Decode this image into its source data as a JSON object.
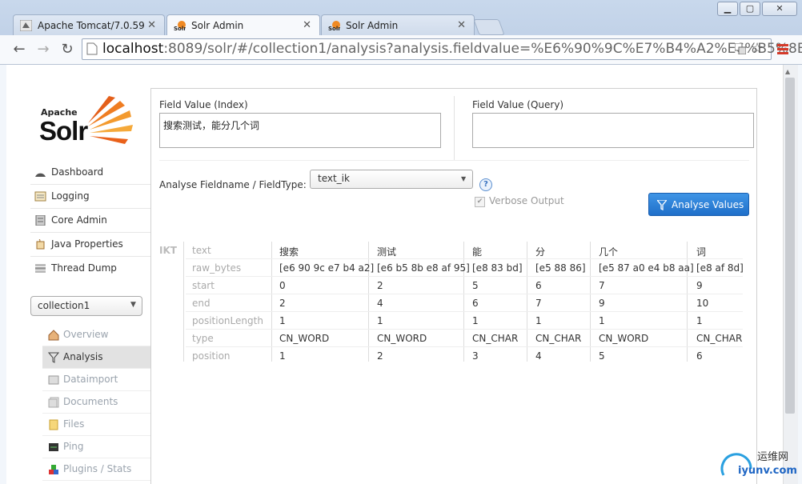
{
  "browser": {
    "tabs": [
      {
        "title": "Apache Tomcat/7.0.59"
      },
      {
        "title": "Solr Admin",
        "active": true
      },
      {
        "title": "Solr Admin"
      }
    ],
    "address": {
      "host": "localhost",
      "rest": ":8089/solr/#/collection1/analysis?analysis.fieldvalue=%E6%90%9C%E7%B4%A2%E6%B5%8B%E"
    }
  },
  "logo": {
    "apache": "Apache",
    "solr": "Solr"
  },
  "sidebar": {
    "items": [
      {
        "label": "Dashboard",
        "icon": "dashboard-icon"
      },
      {
        "label": "Logging",
        "icon": "logging-icon"
      },
      {
        "label": "Core Admin",
        "icon": "core-admin-icon"
      },
      {
        "label": "Java Properties",
        "icon": "java-icon"
      },
      {
        "label": "Thread Dump",
        "icon": "thread-dump-icon"
      }
    ],
    "core_selector": "collection1",
    "core_items": [
      {
        "label": "Overview",
        "icon": "home-icon"
      },
      {
        "label": "Analysis",
        "icon": "filter-icon",
        "active": true
      },
      {
        "label": "Dataimport",
        "icon": "dataimport-icon"
      },
      {
        "label": "Documents",
        "icon": "documents-icon"
      },
      {
        "label": "Files",
        "icon": "files-icon"
      },
      {
        "label": "Ping",
        "icon": "ping-icon"
      },
      {
        "label": "Plugins / Stats",
        "icon": "plugins-icon"
      }
    ]
  },
  "analysis": {
    "index_label": "Field Value (Index)",
    "index_value": "搜索测试，能分几个词",
    "query_label": "Field Value (Query)",
    "query_value": "",
    "fieldtype_label": "Analyse Fieldname / FieldType:",
    "fieldtype_value": "text_ik",
    "help": "?",
    "verbose_label": "Verbose Output",
    "button_label": "Analyse Values"
  },
  "result": {
    "analyzer": "IKT",
    "attributes": [
      "text",
      "raw_bytes",
      "start",
      "end",
      "positionLength",
      "type",
      "position"
    ],
    "tokens": [
      {
        "text": "搜索",
        "raw_bytes": "[e6 90 9c e7 b4 a2]",
        "start": "0",
        "end": "2",
        "positionLength": "1",
        "type": "CN_WORD",
        "position": "1"
      },
      {
        "text": "测试",
        "raw_bytes": "[e6 b5 8b e8 af 95]",
        "start": "2",
        "end": "4",
        "positionLength": "1",
        "type": "CN_WORD",
        "position": "2"
      },
      {
        "text": "能",
        "raw_bytes": "[e8 83 bd]",
        "start": "5",
        "end": "6",
        "positionLength": "1",
        "type": "CN_CHAR",
        "position": "3"
      },
      {
        "text": "分",
        "raw_bytes": "[e5 88 86]",
        "start": "6",
        "end": "7",
        "positionLength": "1",
        "type": "CN_CHAR",
        "position": "4"
      },
      {
        "text": "几个",
        "raw_bytes": "[e5 87 a0 e4 b8 aa]",
        "start": "7",
        "end": "9",
        "positionLength": "1",
        "type": "CN_WORD",
        "position": "5"
      },
      {
        "text": "词",
        "raw_bytes": "[e8 af 8d]",
        "start": "9",
        "end": "10",
        "positionLength": "1",
        "type": "CN_CHAR",
        "position": "6"
      }
    ]
  },
  "watermark": {
    "line1": "运维网",
    "line2": "iyunv.com"
  }
}
